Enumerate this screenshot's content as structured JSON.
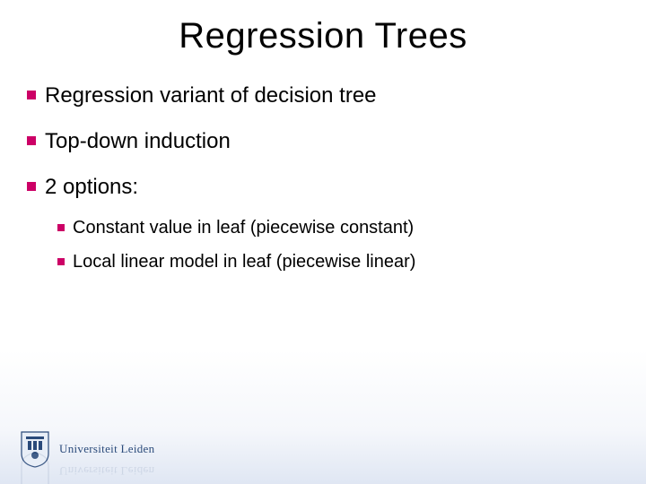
{
  "title": "Regression Trees",
  "bullets": [
    {
      "text": "Regression variant of decision tree"
    },
    {
      "text": "Top-down induction"
    },
    {
      "text": "2 options:"
    }
  ],
  "sub_bullets": [
    {
      "text": "Constant value in leaf (piecewise constant)"
    },
    {
      "text": "Local linear model in leaf (piecewise linear)"
    }
  ],
  "footer": {
    "university": "Universiteit Leiden"
  }
}
